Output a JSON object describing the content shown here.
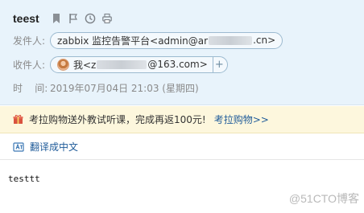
{
  "mail": {
    "subject": "teest",
    "from_label": "发件人:",
    "from_value_prefix": "zabbix 监控告警平台<admin@ar",
    "from_value_suffix": ".cn>",
    "to_label": "收件人:",
    "to_value_prefix": "我<z",
    "to_value_suffix": "@163.com>",
    "to_add_symbol": "+",
    "time_label": "时    间:",
    "time_value": "2019年07月04日 21:03 (星期四)"
  },
  "toolbar": {
    "icons": [
      "bookmark-icon",
      "flag-icon",
      "clock-icon",
      "print-icon"
    ]
  },
  "promo": {
    "text": "考拉购物送外教试听课，完成再返100元!",
    "link": "考拉购物>>"
  },
  "translate": {
    "link": "翻译成中文"
  },
  "content": {
    "body": "testtt"
  },
  "watermark": "@51CTO博客",
  "colors": {
    "header_bg": "#e8f3fb",
    "promo_bg": "#fdf7dd",
    "link": "#1f5b99",
    "chip_border": "#9cbad0"
  }
}
